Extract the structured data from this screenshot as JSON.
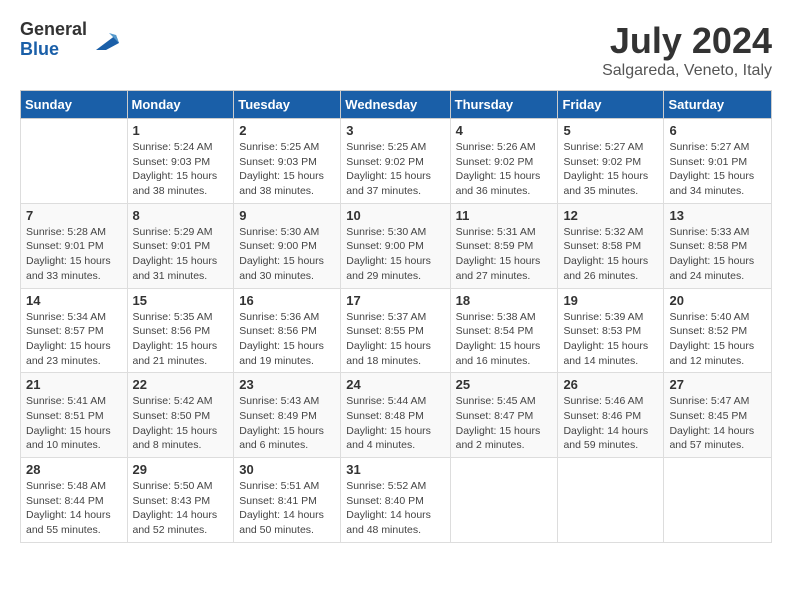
{
  "logo": {
    "general": "General",
    "blue": "Blue"
  },
  "title": "July 2024",
  "subtitle": "Salgareda, Veneto, Italy",
  "weekdays": [
    "Sunday",
    "Monday",
    "Tuesday",
    "Wednesday",
    "Thursday",
    "Friday",
    "Saturday"
  ],
  "weeks": [
    [
      {
        "day": "",
        "sunrise": "",
        "sunset": "",
        "daylight": ""
      },
      {
        "day": "1",
        "sunrise": "Sunrise: 5:24 AM",
        "sunset": "Sunset: 9:03 PM",
        "daylight": "Daylight: 15 hours and 38 minutes."
      },
      {
        "day": "2",
        "sunrise": "Sunrise: 5:25 AM",
        "sunset": "Sunset: 9:03 PM",
        "daylight": "Daylight: 15 hours and 38 minutes."
      },
      {
        "day": "3",
        "sunrise": "Sunrise: 5:25 AM",
        "sunset": "Sunset: 9:02 PM",
        "daylight": "Daylight: 15 hours and 37 minutes."
      },
      {
        "day": "4",
        "sunrise": "Sunrise: 5:26 AM",
        "sunset": "Sunset: 9:02 PM",
        "daylight": "Daylight: 15 hours and 36 minutes."
      },
      {
        "day": "5",
        "sunrise": "Sunrise: 5:27 AM",
        "sunset": "Sunset: 9:02 PM",
        "daylight": "Daylight: 15 hours and 35 minutes."
      },
      {
        "day": "6",
        "sunrise": "Sunrise: 5:27 AM",
        "sunset": "Sunset: 9:01 PM",
        "daylight": "Daylight: 15 hours and 34 minutes."
      }
    ],
    [
      {
        "day": "7",
        "sunrise": "Sunrise: 5:28 AM",
        "sunset": "Sunset: 9:01 PM",
        "daylight": "Daylight: 15 hours and 33 minutes."
      },
      {
        "day": "8",
        "sunrise": "Sunrise: 5:29 AM",
        "sunset": "Sunset: 9:01 PM",
        "daylight": "Daylight: 15 hours and 31 minutes."
      },
      {
        "day": "9",
        "sunrise": "Sunrise: 5:30 AM",
        "sunset": "Sunset: 9:00 PM",
        "daylight": "Daylight: 15 hours and 30 minutes."
      },
      {
        "day": "10",
        "sunrise": "Sunrise: 5:30 AM",
        "sunset": "Sunset: 9:00 PM",
        "daylight": "Daylight: 15 hours and 29 minutes."
      },
      {
        "day": "11",
        "sunrise": "Sunrise: 5:31 AM",
        "sunset": "Sunset: 8:59 PM",
        "daylight": "Daylight: 15 hours and 27 minutes."
      },
      {
        "day": "12",
        "sunrise": "Sunrise: 5:32 AM",
        "sunset": "Sunset: 8:58 PM",
        "daylight": "Daylight: 15 hours and 26 minutes."
      },
      {
        "day": "13",
        "sunrise": "Sunrise: 5:33 AM",
        "sunset": "Sunset: 8:58 PM",
        "daylight": "Daylight: 15 hours and 24 minutes."
      }
    ],
    [
      {
        "day": "14",
        "sunrise": "Sunrise: 5:34 AM",
        "sunset": "Sunset: 8:57 PM",
        "daylight": "Daylight: 15 hours and 23 minutes."
      },
      {
        "day": "15",
        "sunrise": "Sunrise: 5:35 AM",
        "sunset": "Sunset: 8:56 PM",
        "daylight": "Daylight: 15 hours and 21 minutes."
      },
      {
        "day": "16",
        "sunrise": "Sunrise: 5:36 AM",
        "sunset": "Sunset: 8:56 PM",
        "daylight": "Daylight: 15 hours and 19 minutes."
      },
      {
        "day": "17",
        "sunrise": "Sunrise: 5:37 AM",
        "sunset": "Sunset: 8:55 PM",
        "daylight": "Daylight: 15 hours and 18 minutes."
      },
      {
        "day": "18",
        "sunrise": "Sunrise: 5:38 AM",
        "sunset": "Sunset: 8:54 PM",
        "daylight": "Daylight: 15 hours and 16 minutes."
      },
      {
        "day": "19",
        "sunrise": "Sunrise: 5:39 AM",
        "sunset": "Sunset: 8:53 PM",
        "daylight": "Daylight: 15 hours and 14 minutes."
      },
      {
        "day": "20",
        "sunrise": "Sunrise: 5:40 AM",
        "sunset": "Sunset: 8:52 PM",
        "daylight": "Daylight: 15 hours and 12 minutes."
      }
    ],
    [
      {
        "day": "21",
        "sunrise": "Sunrise: 5:41 AM",
        "sunset": "Sunset: 8:51 PM",
        "daylight": "Daylight: 15 hours and 10 minutes."
      },
      {
        "day": "22",
        "sunrise": "Sunrise: 5:42 AM",
        "sunset": "Sunset: 8:50 PM",
        "daylight": "Daylight: 15 hours and 8 minutes."
      },
      {
        "day": "23",
        "sunrise": "Sunrise: 5:43 AM",
        "sunset": "Sunset: 8:49 PM",
        "daylight": "Daylight: 15 hours and 6 minutes."
      },
      {
        "day": "24",
        "sunrise": "Sunrise: 5:44 AM",
        "sunset": "Sunset: 8:48 PM",
        "daylight": "Daylight: 15 hours and 4 minutes."
      },
      {
        "day": "25",
        "sunrise": "Sunrise: 5:45 AM",
        "sunset": "Sunset: 8:47 PM",
        "daylight": "Daylight: 15 hours and 2 minutes."
      },
      {
        "day": "26",
        "sunrise": "Sunrise: 5:46 AM",
        "sunset": "Sunset: 8:46 PM",
        "daylight": "Daylight: 14 hours and 59 minutes."
      },
      {
        "day": "27",
        "sunrise": "Sunrise: 5:47 AM",
        "sunset": "Sunset: 8:45 PM",
        "daylight": "Daylight: 14 hours and 57 minutes."
      }
    ],
    [
      {
        "day": "28",
        "sunrise": "Sunrise: 5:48 AM",
        "sunset": "Sunset: 8:44 PM",
        "daylight": "Daylight: 14 hours and 55 minutes."
      },
      {
        "day": "29",
        "sunrise": "Sunrise: 5:50 AM",
        "sunset": "Sunset: 8:43 PM",
        "daylight": "Daylight: 14 hours and 52 minutes."
      },
      {
        "day": "30",
        "sunrise": "Sunrise: 5:51 AM",
        "sunset": "Sunset: 8:41 PM",
        "daylight": "Daylight: 14 hours and 50 minutes."
      },
      {
        "day": "31",
        "sunrise": "Sunrise: 5:52 AM",
        "sunset": "Sunset: 8:40 PM",
        "daylight": "Daylight: 14 hours and 48 minutes."
      },
      {
        "day": "",
        "sunrise": "",
        "sunset": "",
        "daylight": ""
      },
      {
        "day": "",
        "sunrise": "",
        "sunset": "",
        "daylight": ""
      },
      {
        "day": "",
        "sunrise": "",
        "sunset": "",
        "daylight": ""
      }
    ]
  ]
}
